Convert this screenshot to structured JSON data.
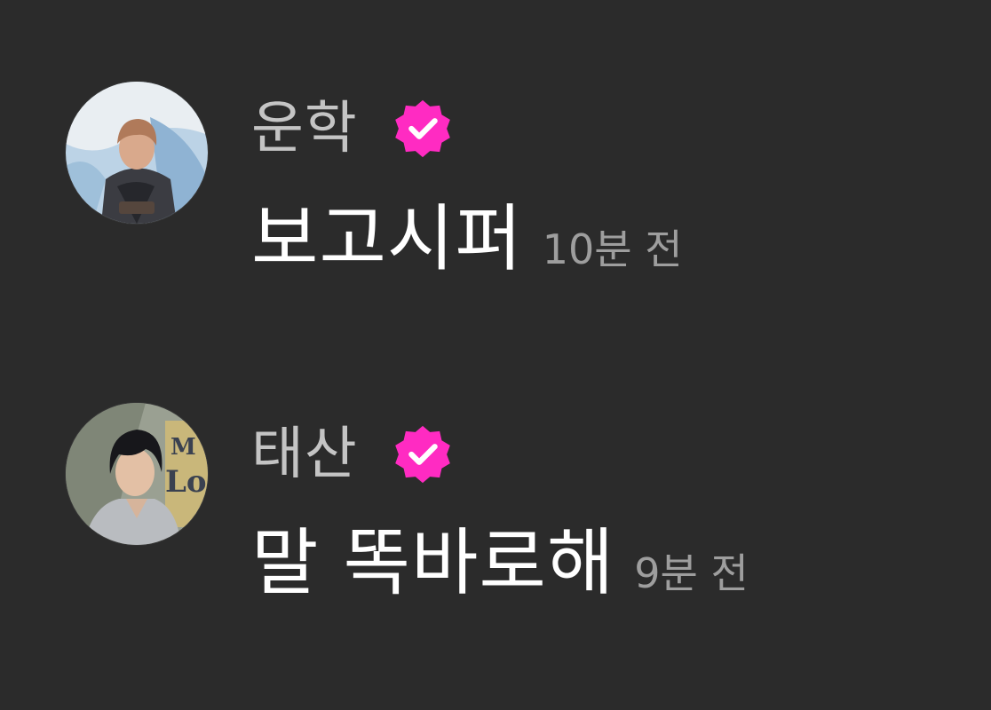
{
  "colors": {
    "background": "#2b2b2b",
    "username": "#c4c4c4",
    "message": "#ffffff",
    "timestamp": "#9e9e9e",
    "verified_badge": "#ff2bc2"
  },
  "comments": [
    {
      "username": "운학",
      "verified_icon": "verified-badge-icon",
      "message": "보고시퍼",
      "time": "10분 전"
    },
    {
      "username": "태산",
      "verified_icon": "verified-badge-icon",
      "message": "말 똑바로해",
      "time": "9분 전"
    }
  ]
}
